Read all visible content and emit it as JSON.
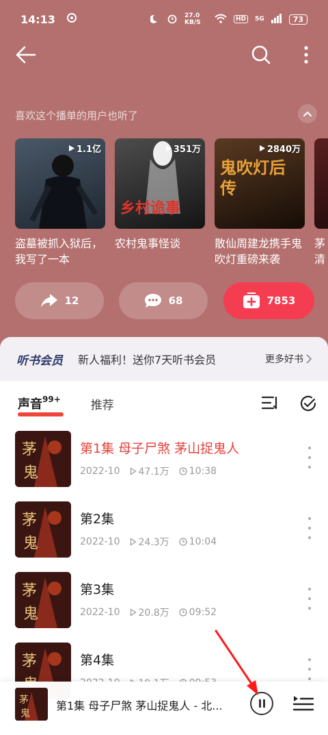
{
  "status": {
    "time": "14:13",
    "network_speed": "27.0 KB/S",
    "hd": "HD",
    "signal": "5G",
    "battery": "73"
  },
  "header": {
    "back_icon": "arrow-left-icon",
    "search_icon": "search-icon",
    "more_icon": "more-vertical-icon"
  },
  "recommend": {
    "title": "喜欢这个播单的用户也听了",
    "cards": [
      {
        "count": "1.1亿",
        "title": "盗墓被抓入狱后，我写了一本",
        "cover_text": "",
        "colors": [
          "#4a5868",
          "#1e2630"
        ]
      },
      {
        "count": "351万",
        "title": "农村鬼事怪谈",
        "cover_text": "乡村诡事",
        "colors": [
          "#4d4d4d",
          "#141414"
        ]
      },
      {
        "count": "2840万",
        "title": "散仙周建龙携手鬼吹灯重磅来袭",
        "cover_text": "鬼吹灯后传",
        "colors": [
          "#5a3a22",
          "#150c06"
        ]
      },
      {
        "count": "",
        "title": "茅清",
        "cover_text": "",
        "colors": [
          "#5a1f1f",
          "#1a0808"
        ]
      }
    ]
  },
  "actions": {
    "share_count": "12",
    "comment_count": "68",
    "subscribe_count": "7853"
  },
  "vip": {
    "tag": "听书会员",
    "text": "新人福利！送你7天听书会员",
    "more": "更多好书"
  },
  "tabs": {
    "active": "声音",
    "badge": "99+",
    "other": "推荐"
  },
  "episodes": [
    {
      "title": "第1集 母子尸煞 茅山捉鬼人",
      "date": "2022-10",
      "plays": "47.1万",
      "duration": "10:38",
      "active": true
    },
    {
      "title": "第2集",
      "date": "2022-10",
      "plays": "24.3万",
      "duration": "10:04",
      "active": false
    },
    {
      "title": "第3集",
      "date": "2022-10",
      "plays": "20.8万",
      "duration": "09:52",
      "active": false
    },
    {
      "title": "第4集",
      "date": "2022-10",
      "plays": "19.1万",
      "duration": "09:53",
      "active": false
    }
  ],
  "player": {
    "title": "第1集 母子尸煞 茅山捉鬼人 - 北...",
    "pause_icon": "pause-icon",
    "playlist_icon": "playlist-icon"
  },
  "colors": {
    "background": "#b3706e",
    "accent_red": "#f0453a",
    "active_episode": "#e6413b"
  }
}
